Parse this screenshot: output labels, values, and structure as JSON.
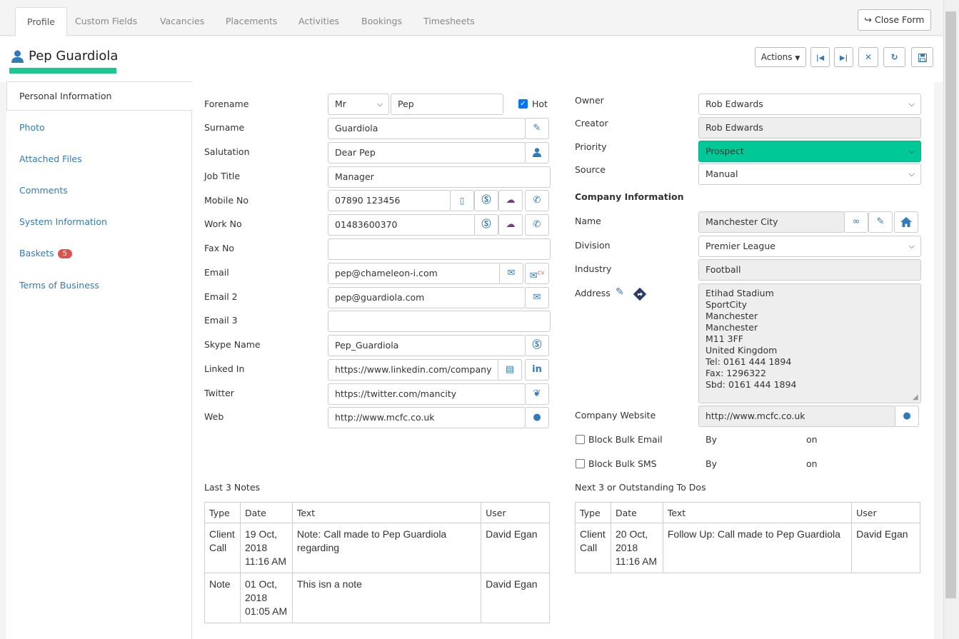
{
  "tabs": [
    "Profile",
    "Custom Fields",
    "Vacancies",
    "Placements",
    "Activities",
    "Bookings",
    "Timesheets"
  ],
  "close_form": "Close Form",
  "title": "Pep Guardiola",
  "actions_label": "Actions",
  "sidebar": {
    "items": [
      "Personal Information",
      "Photo",
      "Attached Files",
      "Comments",
      "System Information",
      "Baskets",
      "Terms of Business"
    ],
    "baskets_count": "5"
  },
  "personal": {
    "forename_label": "Forename",
    "title_value": "Mr",
    "forename_value": "Pep",
    "hot_label": "Hot",
    "surname_label": "Surname",
    "surname_value": "Guardiola",
    "salutation_label": "Salutation",
    "salutation_value": "Dear Pep",
    "jobtitle_label": "Job Title",
    "jobtitle_value": "Manager",
    "mobile_label": "Mobile No",
    "mobile_value": "07890 123456",
    "work_label": "Work No",
    "work_value": "01483600370",
    "fax_label": "Fax No",
    "fax_value": "",
    "email_label": "Email",
    "email_value": "pep@chameleon-i.com",
    "email2_label": "Email 2",
    "email2_value": "pep@guardiola.com",
    "email3_label": "Email 3",
    "email3_value": "",
    "skype_label": "Skype Name",
    "skype_value": "Pep_Guardiola",
    "linkedin_label": "Linked In",
    "linkedin_value": "https://www.linkedin.com/company",
    "twitter_label": "Twitter",
    "twitter_value": "https://twitter.com/mancity",
    "web_label": "Web",
    "web_value": "http://www.mcfc.co.uk"
  },
  "right": {
    "owner_label": "Owner",
    "owner_value": "Rob Edwards",
    "creator_label": "Creator",
    "creator_value": "Rob Edwards",
    "priority_label": "Priority",
    "priority_value": "Prospect",
    "priority_color": "#00c896",
    "source_label": "Source",
    "source_value": "Manual",
    "company_heading": "Company Information",
    "name_label": "Name",
    "name_value": "Manchester City",
    "division_label": "Division",
    "division_value": "Premier League",
    "industry_label": "Industry",
    "industry_value": "Football",
    "address_label": "Address",
    "address_lines": [
      "Etihad Stadium",
      "SportCity",
      "Manchester",
      "Manchester",
      "M11 3FF",
      "United Kingdom",
      "Tel: 0161 444 1894",
      "Fax: 1296322",
      "Sbd: 0161 444 1894"
    ],
    "website_label": "Company Website",
    "website_value": "http://www.mcfc.co.uk",
    "block_email_label": "Block Bulk Email",
    "block_sms_label": "Block Bulk SMS",
    "by_label": "By",
    "on_label": "on"
  },
  "notes": {
    "heading": "Last 3 Notes",
    "headers": [
      "Type",
      "Date",
      "Text",
      "User"
    ],
    "rows": [
      [
        "Client Call",
        "19 Oct, 2018 11:16 AM",
        "Note: Call made to Pep Guardiola regarding",
        "David Egan"
      ],
      [
        "Note",
        "01 Oct, 2018 01:05 AM",
        "This isn a note",
        "David Egan"
      ]
    ]
  },
  "todos": {
    "heading": "Next 3 or Outstanding To Dos",
    "headers": [
      "Type",
      "Date",
      "Text",
      "User"
    ],
    "rows": [
      [
        "Client Call",
        "20 Oct, 2018 11:16 AM",
        "Follow Up: Call made to Pep Guardiola",
        "David Egan"
      ]
    ]
  },
  "icons": {
    "user": "user-icon",
    "edit": "edit-icon",
    "mobile": "mobile-icon",
    "skype": "skype-icon",
    "phone": "phone-icon",
    "mail": "envelope-icon",
    "linkedin": "linkedin-icon",
    "twitter": "twitter-icon",
    "globe": "globe-icon",
    "link": "link-icon",
    "home": "home-icon"
  },
  "colors": {
    "link": "#337ab7",
    "accent": "#1cc690",
    "badge": "#d9534f"
  }
}
